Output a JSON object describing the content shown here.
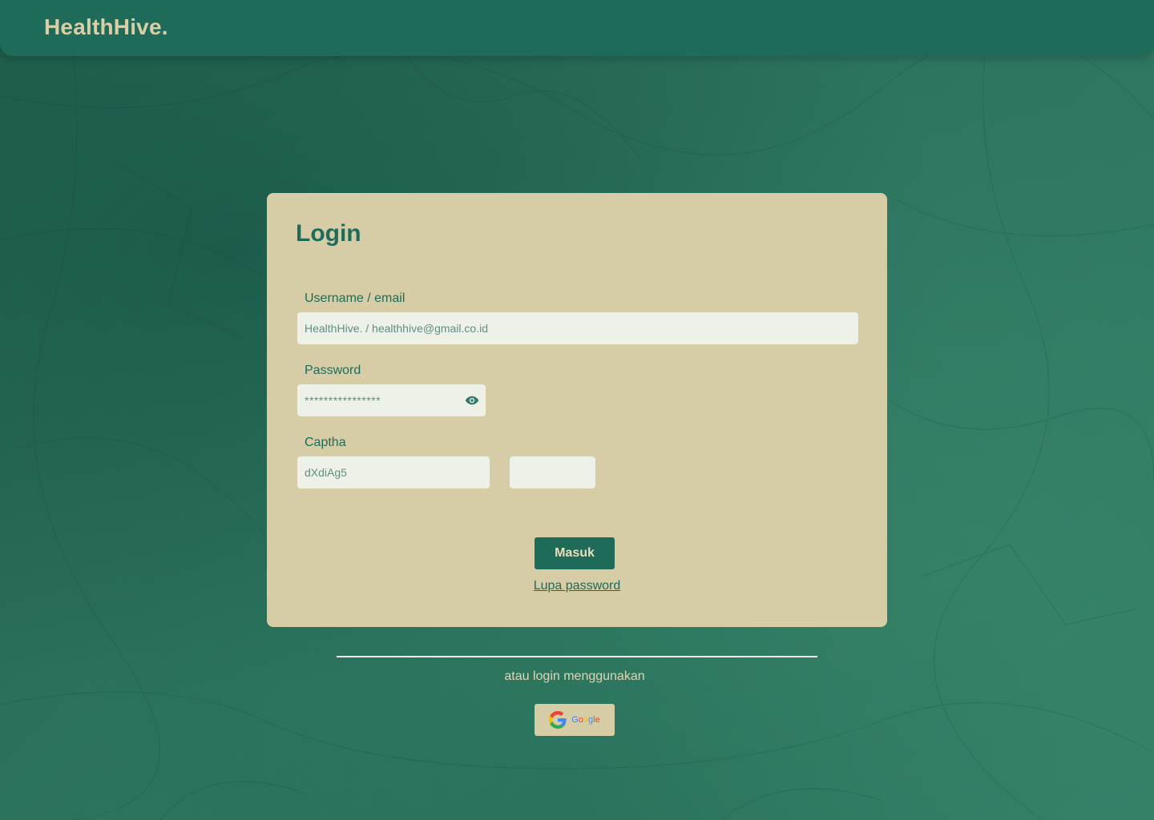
{
  "navbar": {
    "brand": "HealthHive."
  },
  "login": {
    "title": "Login",
    "username_label": "Username / email",
    "username_value": "HealthHive. / healthhive@gmail.co.id",
    "password_label": "Password",
    "password_value": "****************",
    "captcha_label": "Captha",
    "captcha_code": "dXdiAg5",
    "captcha_input_value": "",
    "submit_label": "Masuk",
    "forgot_label": "Lupa password"
  },
  "alternative": {
    "text": "atau login menggunakan",
    "google_label": "Google"
  },
  "icons": {
    "password_toggle": "eye-icon",
    "google": "google-logo-icon"
  },
  "colors": {
    "primary": "#1f6b5a",
    "card": "#d6cda6",
    "field": "#edf1e8",
    "brand_text": "#d8cfa6"
  }
}
